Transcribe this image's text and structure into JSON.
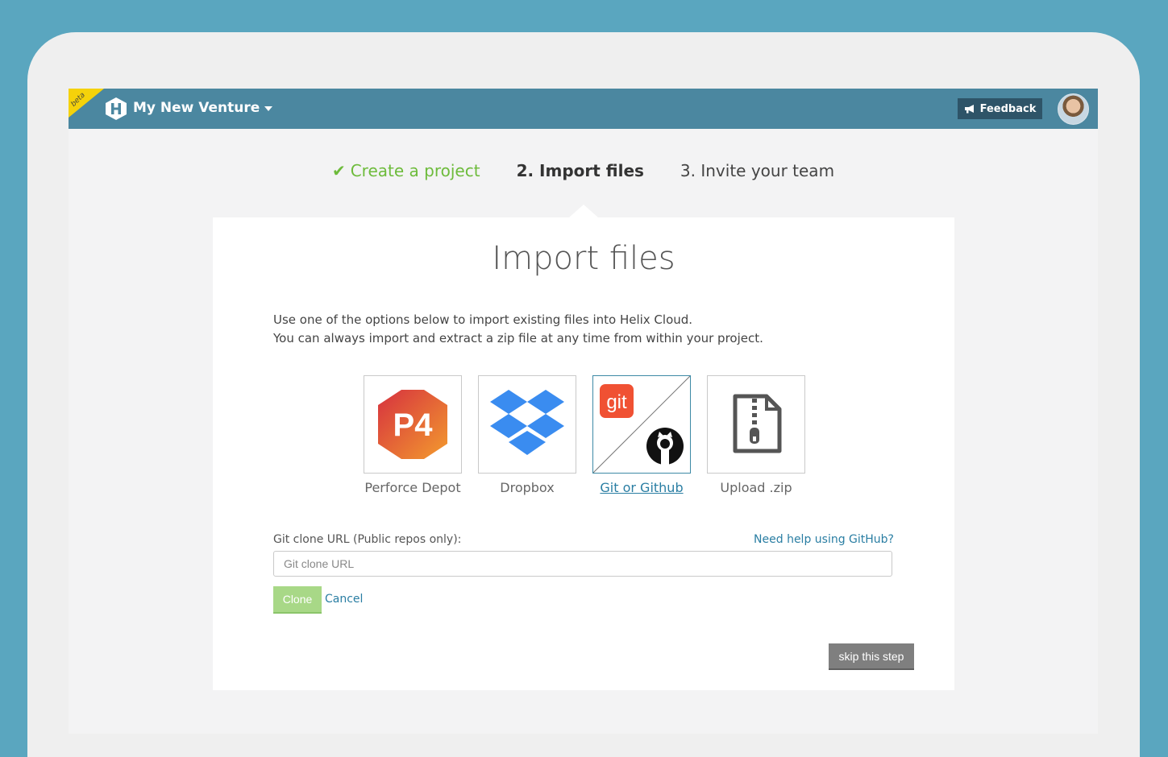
{
  "header": {
    "beta_label": "beta",
    "venture_name": "My New Venture",
    "feedback_label": "Feedback"
  },
  "steps": [
    {
      "label": "Create a project",
      "state": "done"
    },
    {
      "label": "2. Import files",
      "state": "active"
    },
    {
      "label": "3. Invite your team",
      "state": "upcoming"
    }
  ],
  "card": {
    "title": "Import files",
    "intro_line1": "Use one of the options below to import existing files into Helix Cloud.",
    "intro_line2": "You can always import and extract a zip file at any time from within your project."
  },
  "options": [
    {
      "label": "Perforce Depot",
      "icon": "p4-icon",
      "tile_text": "P4"
    },
    {
      "label": "Dropbox",
      "icon": "dropbox-icon"
    },
    {
      "label": "Git or Github",
      "icon": "git-github-icon",
      "tile_text": "git",
      "selected": true
    },
    {
      "label": "Upload .zip",
      "icon": "zip-file-icon"
    }
  ],
  "git_form": {
    "field_label": "Git clone URL (Public repos only):",
    "help_link": "Need help using GitHub?",
    "placeholder": "Git clone URL",
    "value": "",
    "clone_label": "Clone",
    "cancel_label": "Cancel"
  },
  "skip_label": "skip this step",
  "colors": {
    "background": "#5aa6bf",
    "topbar": "#4b87a0",
    "accent_green": "#6dbb3b",
    "link_blue": "#2a7ea3",
    "beta_yellow": "#f5d20a"
  }
}
